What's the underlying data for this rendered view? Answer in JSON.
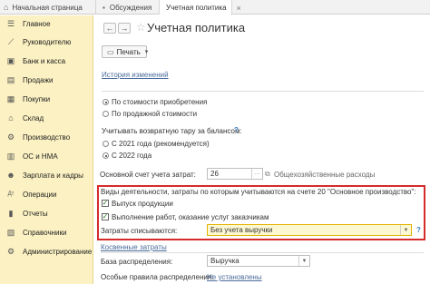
{
  "tabs": [
    {
      "label": "Начальная страница",
      "icon": "home-icon"
    },
    {
      "label": "Обсуждения",
      "icon": "chat-icon"
    },
    {
      "label": "Учетная политика",
      "close": "×"
    }
  ],
  "sidebar": {
    "items": [
      {
        "label": "Главное",
        "icon": "menu-icon",
        "glyph": "☰"
      },
      {
        "label": "Руководителю",
        "icon": "chart-line-icon",
        "glyph": "⟋"
      },
      {
        "label": "Банк и касса",
        "icon": "bank-icon",
        "glyph": "▣"
      },
      {
        "label": "Продажи",
        "icon": "cart-icon",
        "glyph": "▤"
      },
      {
        "label": "Покупки",
        "icon": "basket-icon",
        "glyph": "▦"
      },
      {
        "label": "Склад",
        "icon": "warehouse-icon",
        "glyph": "⌂"
      },
      {
        "label": "Производство",
        "icon": "factory-icon",
        "glyph": "⚙"
      },
      {
        "label": "ОС и НМА",
        "icon": "assets-icon",
        "glyph": "▥"
      },
      {
        "label": "Зарплата и кадры",
        "icon": "people-icon",
        "glyph": "☻"
      },
      {
        "label": "Операции",
        "icon": "operations-icon",
        "glyph": "Дт"
      },
      {
        "label": "Отчеты",
        "icon": "reports-icon",
        "glyph": "▮"
      },
      {
        "label": "Справочники",
        "icon": "books-icon",
        "glyph": "▧"
      },
      {
        "label": "Администрирование",
        "icon": "gear-icon",
        "glyph": "⚙"
      }
    ]
  },
  "header": {
    "back": "←",
    "forward": "→",
    "star": "☆",
    "title": "Учетная политика"
  },
  "toolbar": {
    "print_label": "Печать",
    "print_arrow": "▾"
  },
  "form": {
    "history_link": "История изменений",
    "cost_option_purchase": "По стоимости приобретения",
    "cost_option_sale": "По продажной стоимости",
    "returnable_label": "Учитывать возвратную тару за балансом:",
    "returnable_help": "?",
    "year_option_2021": "С 2021 года (рекомендуется)",
    "year_option_2022": "С 2022 года",
    "main_account_label": "Основной счет учета затрат:",
    "main_account_value": "26",
    "main_account_desc": "Общехозяйственные расходы",
    "activities_label": "Виды деятельности, затраты по которым учитываются на счете 20 \"Основное производство\":",
    "check_output": "Выпуск продукции",
    "check_services": "Выполнение работ, оказание услуг заказчикам",
    "writeoff_label": "Затраты списываются:",
    "writeoff_value": "Без учета выручки",
    "writeoff_help": "?",
    "indirect_link": "Косвенные затраты",
    "distribution_base_label": "База распределения:",
    "distribution_base_value": "Выручка",
    "special_rules_label": "Особые правила распределения:",
    "special_rules_link": "Не установлены"
  },
  "colors": {
    "sidebar_bg": "#fbf1c2",
    "highlight_border": "#d62b2b",
    "link": "#4a6b9a",
    "help": "#3b7fc4"
  }
}
